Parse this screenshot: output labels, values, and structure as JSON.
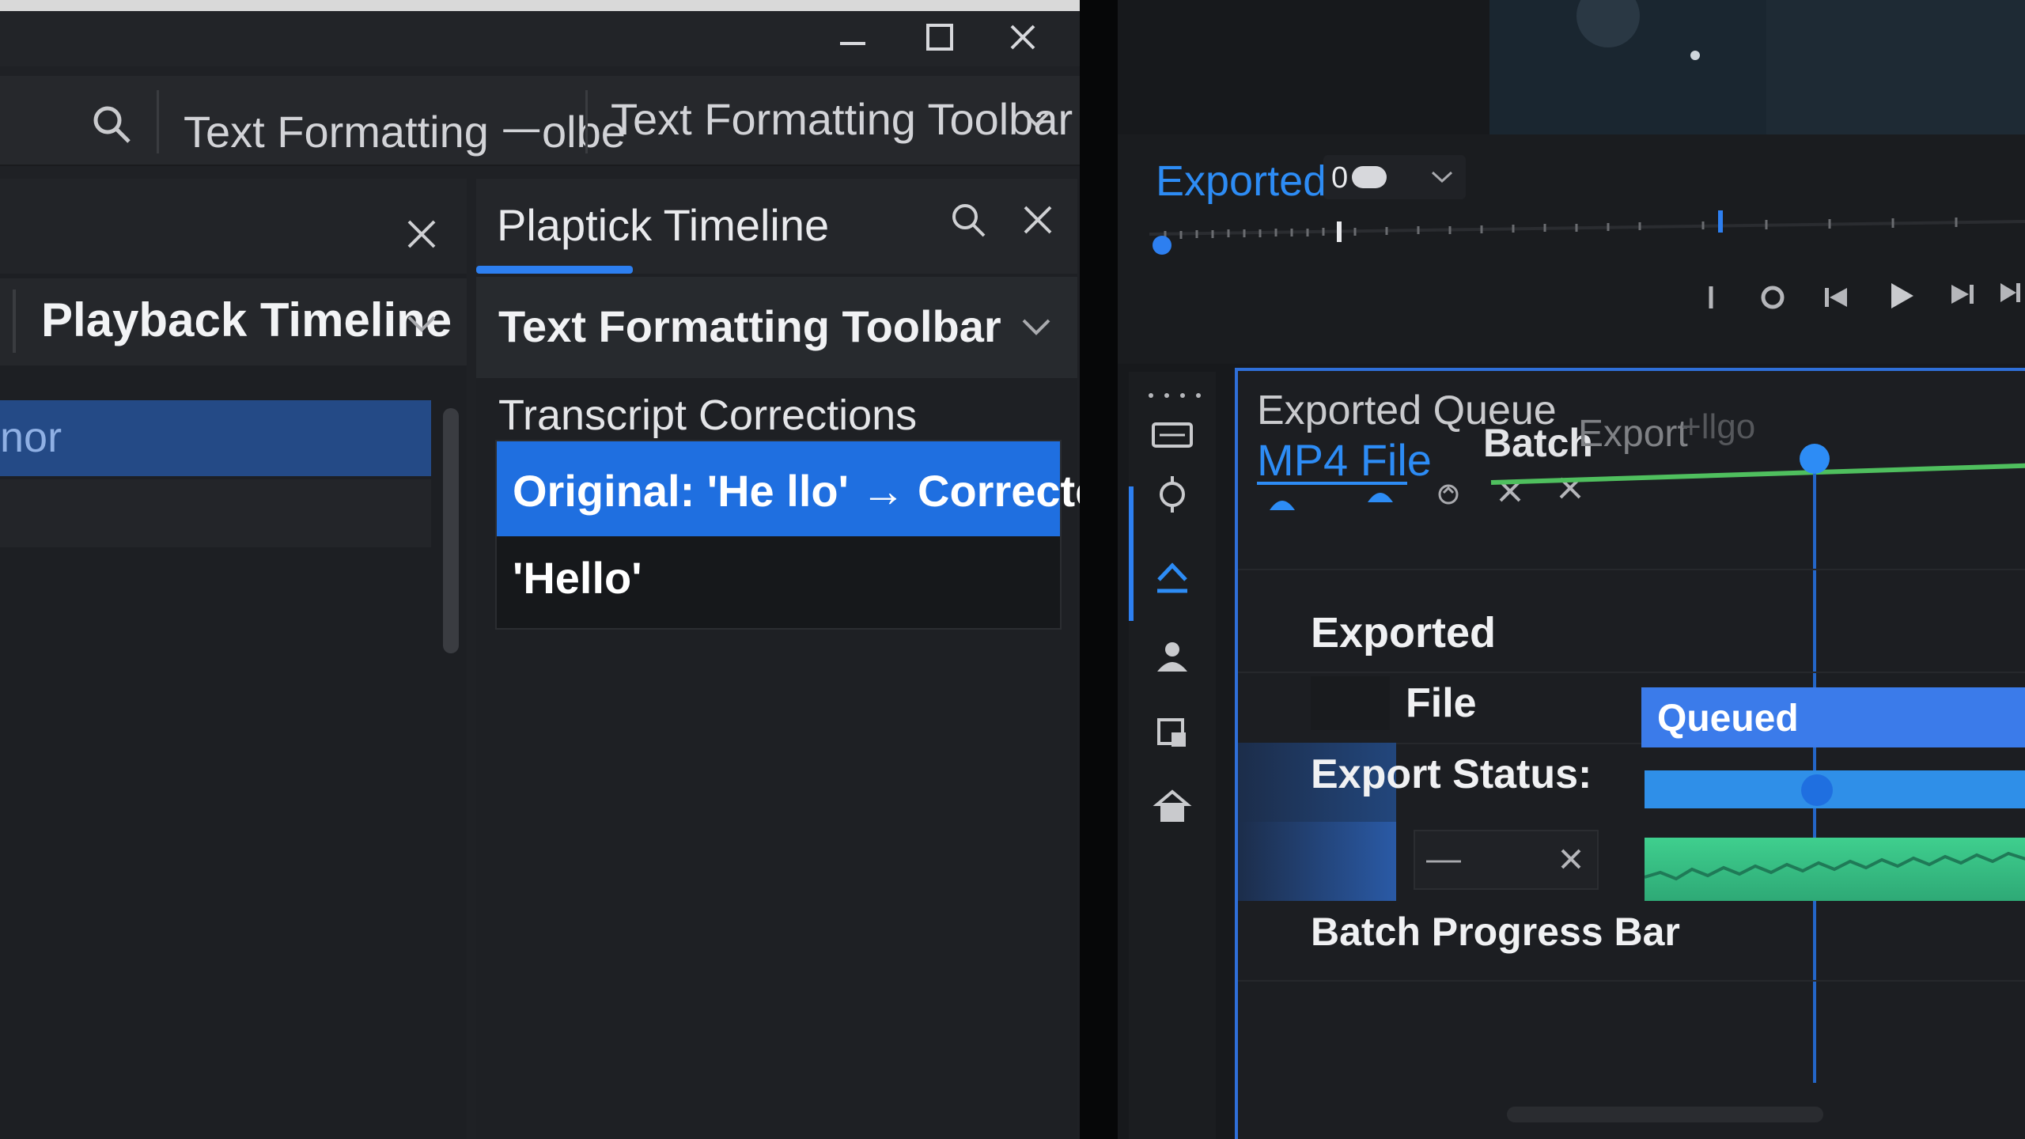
{
  "left": {
    "tabs": [
      "Text Formatting ᅳolbe",
      "Text Formatting Toolbar"
    ],
    "panel": {
      "title": "Playback Timeline",
      "selected_item": "nor"
    },
    "mid": {
      "tab": "Plaptick Timeline",
      "subtitle": "Text Formatting Toolbar",
      "section": "Transcript Corrections",
      "correction_line1": "Original: 'He llo' → Corrected:",
      "correction_line2": "'Hello'"
    }
  },
  "right": {
    "exported_label": "Exported",
    "dropdown_value": "0",
    "queue": {
      "title": "Exported Queue",
      "active_tab": "MP4 File",
      "col_batch": "Batch",
      "col_export": "Export",
      "col_extra": "+llgo",
      "rows": {
        "exported": "Exported",
        "file": "File",
        "status": "Export Status:",
        "status_value": "Queued",
        "field_value": "—",
        "progress": "Batch Progress Bar"
      }
    }
  },
  "colors": {
    "accent": "#2d7ff0",
    "selection": "#1f6fe0",
    "progress_green": "#3fcf8e",
    "queued_bar": "#3b7bea"
  },
  "icons": [
    "minimize-icon",
    "maximize-icon",
    "close-icon",
    "search-icon",
    "chevron-down-icon",
    "play-icon",
    "skip-back-icon",
    "skip-forward-icon",
    "record-icon",
    "crosshair-icon",
    "user-icon",
    "home-icon"
  ]
}
